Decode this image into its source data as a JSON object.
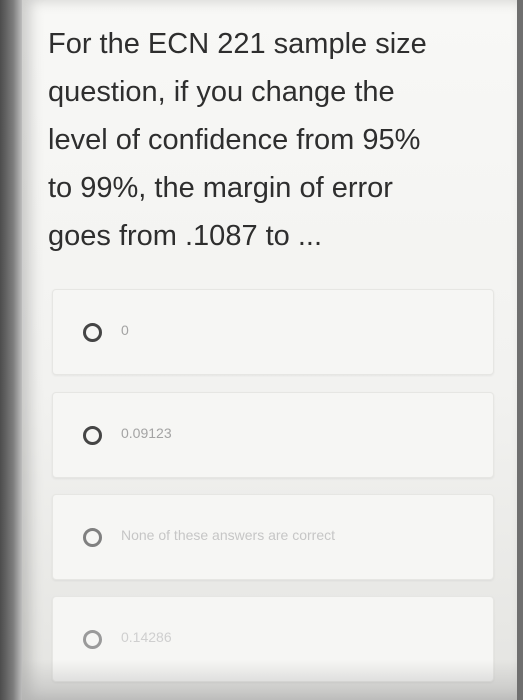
{
  "question": {
    "line1": "For the ECN 221 sample size",
    "line2": "question, if you change the",
    "line3": "level of confidence from 95%",
    "line4": "to 99%, the margin of error",
    "line5": "goes from .1087 to ..."
  },
  "options": [
    {
      "label": "0"
    },
    {
      "label": "0.09123"
    },
    {
      "label": "None of these answers are correct"
    },
    {
      "label": "0.14286"
    }
  ]
}
